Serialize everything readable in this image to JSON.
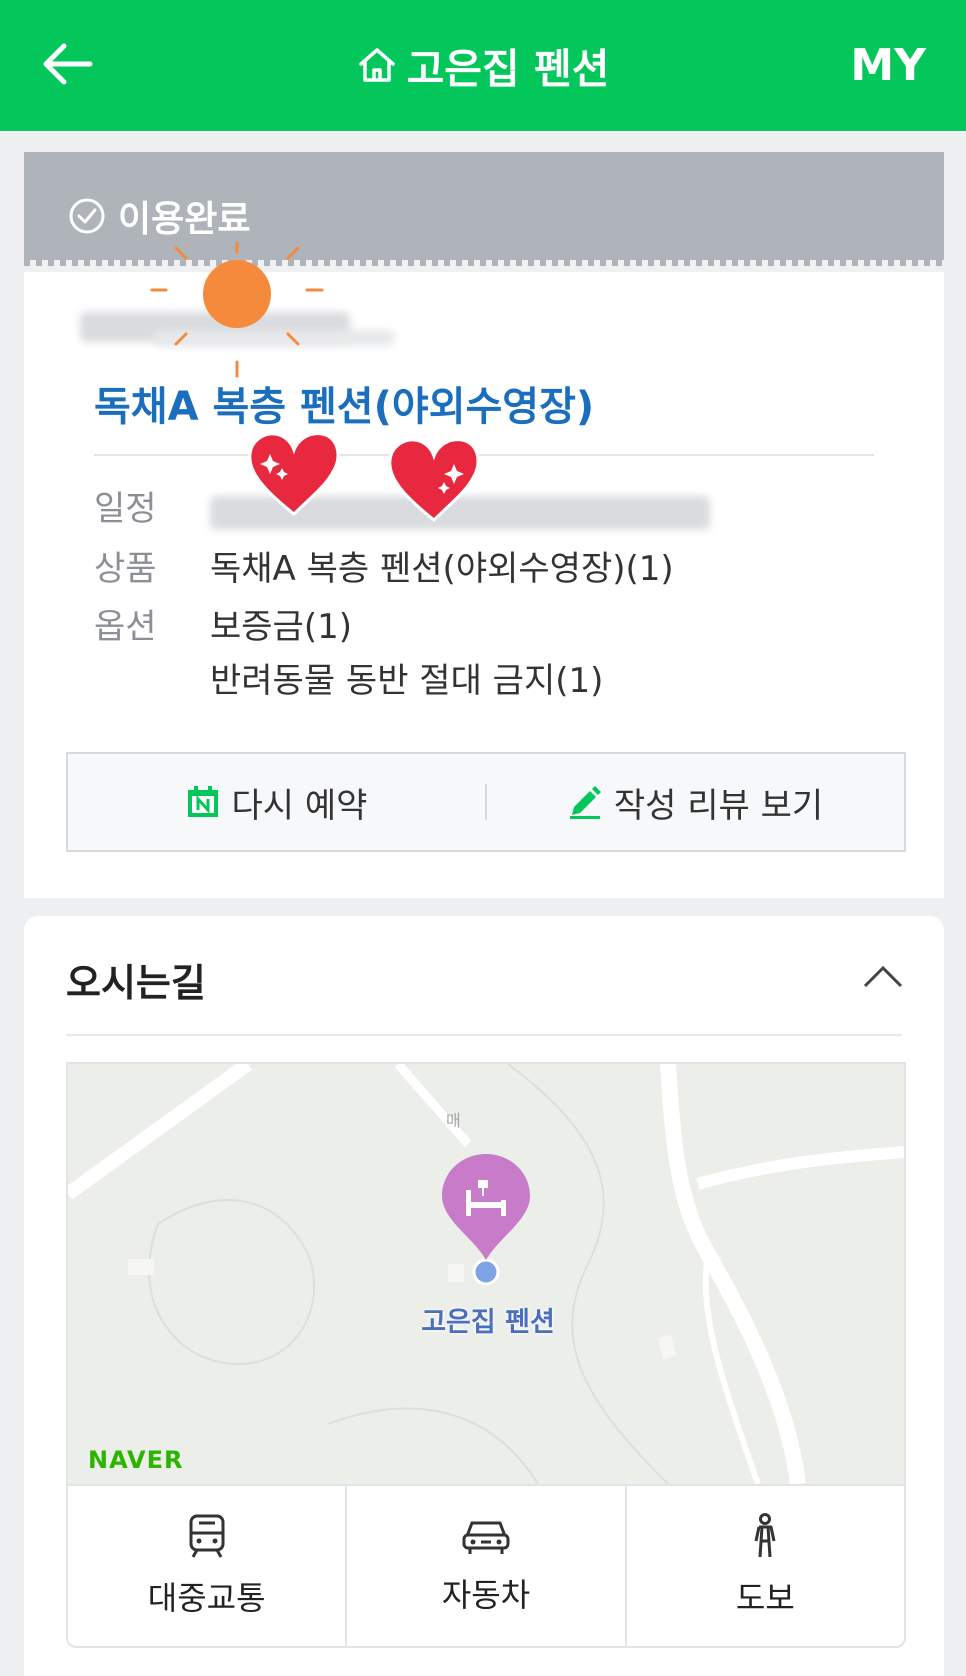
{
  "header": {
    "title": "고은집 펜션",
    "my_label": "MY",
    "icons": [
      "back-arrow-icon",
      "home-icon"
    ]
  },
  "status": {
    "label": "이용완료",
    "icon": "check-circle-icon"
  },
  "booking": {
    "product_title": "독채A 복층 펜션(야외수영장)",
    "rows": [
      {
        "label": "일정",
        "value": ""
      },
      {
        "label": "상품",
        "value": "독채A 복층 펜션(야외수영장)(1)"
      },
      {
        "label": "옵션",
        "value": "보증금(1)",
        "value2": "반려동물 동반 절대 금지(1)"
      }
    ],
    "actions": {
      "rebook_label": "다시 예약",
      "review_label": "작성 리뷰 보기"
    }
  },
  "directions": {
    "title": "오시는길",
    "map": {
      "place_label": "고은집 펜션",
      "provider_logo": "NAVER",
      "small_road_label": "매"
    },
    "transport": [
      {
        "label": "대중교통",
        "icon": "bus-icon"
      },
      {
        "label": "자동차",
        "icon": "car-icon"
      },
      {
        "label": "도보",
        "icon": "walk-icon"
      }
    ]
  },
  "colors": {
    "brand_green": "#03c75a",
    "title_blue": "#1a6ebd",
    "status_gray": "#aeb4ba",
    "pin_purple": "#c87bc9"
  }
}
